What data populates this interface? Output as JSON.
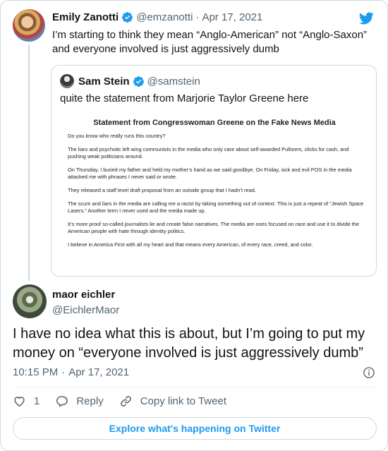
{
  "parent": {
    "name": "Emily Zanotti",
    "handle": "@emzanotti",
    "separator": "·",
    "date": "Apr 17, 2021",
    "text_line1": "I’m starting to think they mean “Anglo-American” not “Anglo-Saxon”",
    "text_line2": "and everyone involved is just aggressively dumb"
  },
  "quote": {
    "name": "Sam Stein",
    "handle": "@samstein",
    "text": "quite the statement from Marjorie Taylor Greene here",
    "statement": {
      "title": "Statement from Congresswoman Greene on the Fake News Media",
      "p1": "Do you know who really runs this country?",
      "p2": "The liars and psychotic left wing communists in the media who only care about self-awarded Pulitzers, clicks for cash, and pushing weak politicians around.",
      "p3": "On Thursday, I buried my father and held my mother’s hand as we said goodbye. On Friday, sick and evil POS in the media attacked me with phrases I never said or wrote.",
      "p4": "They released a staff level draft proposal from an outside group that I hadn’t read.",
      "p5": "The scum and liars in the media are calling me a racist by taking something out of context. This is just a repeat of “Jewish Space Lasers.” Another term I never used and the media made up.",
      "p6": "It’s more proof so-called journalists lie and create false narratives. The media are ones focused on race and use it to divide the American people with hate through identity politics.",
      "p7": "I believe in America First with all my heart and that means every American, of every race, creed, and color."
    }
  },
  "reply": {
    "name": "maor eichler",
    "handle": "@EichlerMaor",
    "text": "I have no idea what this is about, but I’m going to put my money on “everyone involved is just aggressively dumb”",
    "time": "10:15 PM",
    "separator": "·",
    "date": "Apr 17, 2021"
  },
  "actions": {
    "like_count": "1",
    "reply_label": "Reply",
    "copy_label": "Copy link to Tweet"
  },
  "explore_label": "Explore what's happening on Twitter",
  "colors": {
    "accent": "#1d9bf0",
    "text": "#0f1419",
    "muted": "#536471",
    "border": "#cfd9de"
  }
}
